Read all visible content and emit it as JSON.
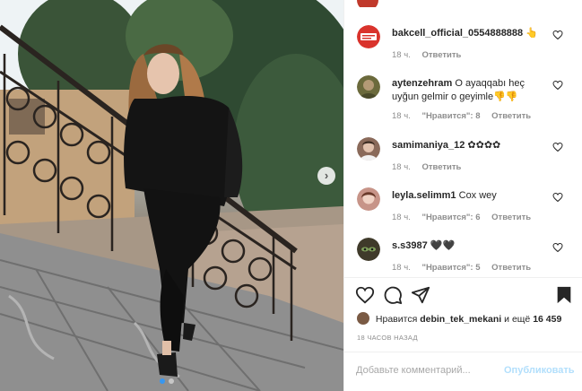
{
  "post": {
    "carousel_next": "›",
    "carousel_dots": 2
  },
  "comments": [
    {
      "username": "bakcell_official_0554888888",
      "text": "👆",
      "time": "18 ч.",
      "likes": "",
      "reply": "Ответить",
      "avatar_color": "#d9332c"
    },
    {
      "username": "aytenzehram",
      "text": "O ayaqqabı heç uyğun gelmir o geyimle👎👎",
      "time": "18 ч.",
      "likes": "\"Нравится\": 8",
      "reply": "Ответить",
      "avatar_color": "#6b6a3c"
    },
    {
      "username": "samimaniya_12",
      "text": "✿✿✿✿",
      "time": "18 ч.",
      "likes": "",
      "reply": "Ответить",
      "avatar_color": "#8a6a5a"
    },
    {
      "username": "leyla.selimm1",
      "text": "Cox wey",
      "time": "18 ч.",
      "likes": "\"Нравится\": 6",
      "reply": "Ответить",
      "avatar_color": "#c79488"
    },
    {
      "username": "s.s3987",
      "text": "🖤🖤",
      "time": "18 ч.",
      "likes": "\"Нравится\": 5",
      "reply": "Ответить",
      "avatar_color": "#3f3a2a"
    }
  ],
  "likes_line": {
    "prefix": "Нравится",
    "user": "debin_tek_mekani",
    "middle": "и ещё",
    "count": "16 459"
  },
  "timestamp": "18 ЧАСОВ НАЗАД",
  "add_comment": {
    "placeholder": "Добавьте комментарий...",
    "publish": "Опубликовать"
  },
  "colors": {
    "accent": "#3897f0",
    "publish_disabled": "#b2dffc",
    "muted": "#8e8e8e"
  }
}
